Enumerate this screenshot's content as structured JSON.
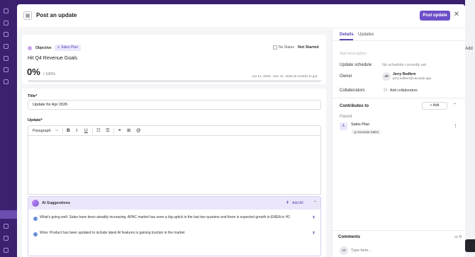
{
  "modal": {
    "title": "Post an update",
    "post_button": "Post update",
    "close_glyph": "✕"
  },
  "objective": {
    "type_label": "Objective",
    "plan_tag": "Sales Plan",
    "no_status_label": "No Status",
    "status": "Not Started",
    "title": "Hit Q4 Revenue Goals",
    "progress_value": "0%",
    "progress_of": "/ 100%",
    "progress_fraction": 0,
    "date_range": "Apr 14, 2026 - Dec 31, 2026 (9 months to go)"
  },
  "form": {
    "title_label": "Title*",
    "title_value": "Update for Apr 2026",
    "update_label": "Update*",
    "paragraph_select": "Paragraph"
  },
  "ai": {
    "title": "AI Suggestions",
    "add_all": "Add All",
    "suggestions": [
      "What's going well: Sales have been steadily increasing. APAC market has seen a big uptick in the last two quarters and there is expected growth in EMEA in H2",
      "Wins: Product has been updated to include latest AI features is gaining traction in the market"
    ]
  },
  "details": {
    "tabs": [
      "Details",
      "Updates"
    ],
    "add_description_placeholder": "Add description",
    "update_schedule_label": "Update schedule",
    "update_schedule_value": "No schedule currently set",
    "owner_label": "Owner",
    "owner_initials": "JR",
    "owner_name": "Jerry Redfern",
    "owner_email": "jerry.redfern@cascade.app",
    "collaborators_label": "Collaborators",
    "add_collaborators": "Add collaborators",
    "contributes_label": "Contributes to",
    "add_button": "Add",
    "parent_label": "Parent",
    "parent_name": "Sales Plan",
    "parent_sub": "Increase Sales",
    "comments_label": "Comments",
    "comments_count": "0",
    "comment_initials": "JR",
    "comment_placeholder": "Type here..."
  },
  "background": {
    "right_add": "Add"
  },
  "colors": {
    "accent": "#6b4fc8",
    "sidebar": "#3b2170"
  }
}
